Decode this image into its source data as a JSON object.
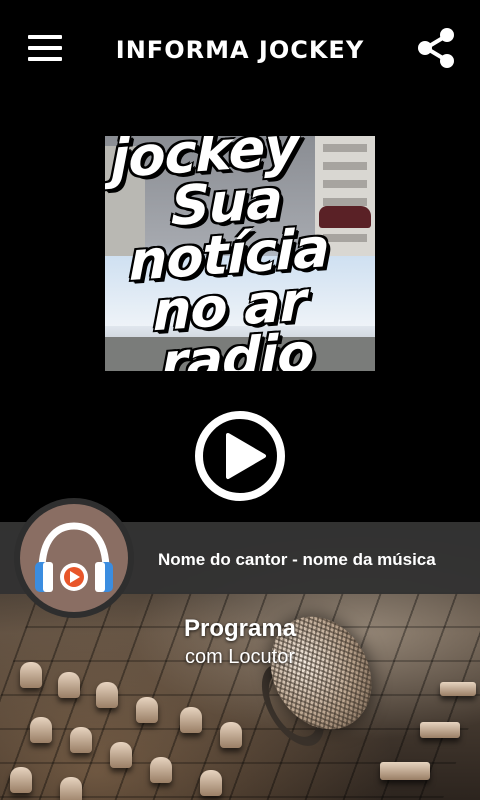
{
  "header": {
    "title": "INFORMA JOCKEY",
    "menu_icon": "hamburger-menu-icon",
    "share_icon": "share-icon"
  },
  "album_art": {
    "lines": [
      "jockey",
      "Sua",
      "notícia",
      "no ar",
      "radio"
    ]
  },
  "player": {
    "play_icon": "play-circle-icon",
    "now_playing": "Nome do cantor - nome da música"
  },
  "program": {
    "title": "Programa",
    "subtitle": "com Locutor"
  },
  "colors": {
    "background": "#000000",
    "bar": "#323232",
    "avatar_bg": "#8a6e63",
    "headphones": "#ffffff",
    "headphones_accent": "#3b8de0",
    "play_badge": "#e8562a"
  }
}
